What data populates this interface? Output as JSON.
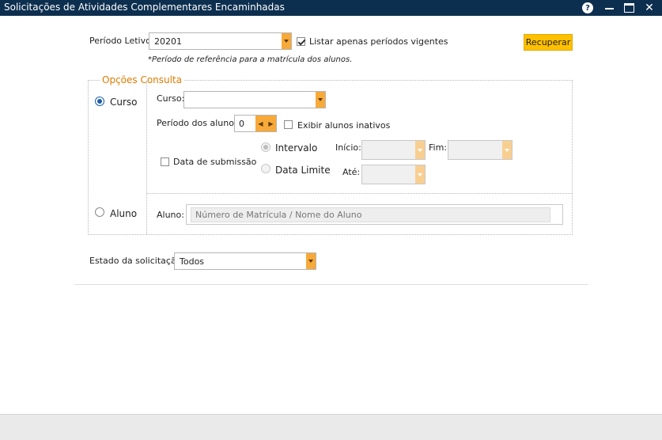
{
  "window": {
    "title": "Solicitações de Atividades Complementares Encaminhadas"
  },
  "periodo": {
    "label": "Período Letivo:",
    "value": "20201",
    "listar_label": "Listar apenas períodos vigentes",
    "listar_checked": true,
    "note": "*Período de referência para a matrícula dos alunos."
  },
  "recuperar_label": "Recuperar",
  "opcoes": {
    "legend": "Opções Consulta",
    "curso_radio": "Curso",
    "aluno_radio": "Aluno",
    "curso_label": "Curso:",
    "curso_value": "",
    "periodo_alunos_label": "Período dos alunos:",
    "periodo_alunos_value": "0",
    "exibir_inativos_label": "Exibir alunos inativos",
    "data_submissao_label": "Data de submissão",
    "intervalo_label": "Intervalo",
    "data_limite_label": "Data Limite",
    "inicio_label": "Início:",
    "fim_label": "Fim:",
    "ate_label": "Até:",
    "aluno_label": "Aluno:",
    "aluno_placeholder": "Número de Matrícula / Nome do Aluno"
  },
  "estado": {
    "label": "Estado da solicitação:",
    "value": "Todos"
  },
  "colors": {
    "titlebar": "#0d2f4f",
    "accent": "#e07b00",
    "button": "#ffc000",
    "dropdown": "#f7a93a"
  }
}
